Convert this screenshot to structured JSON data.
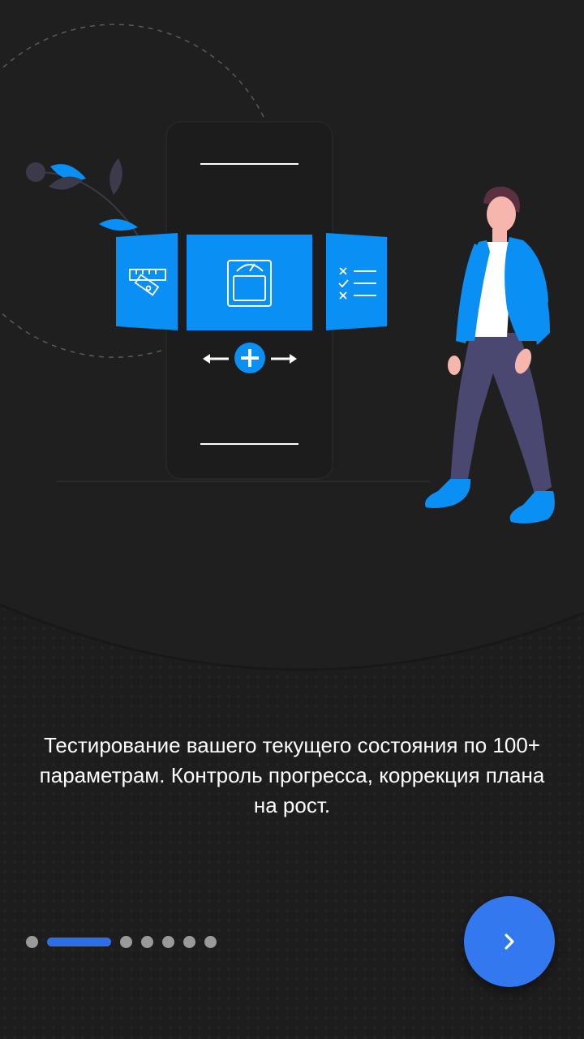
{
  "onboarding": {
    "description": "Тестирование вашего текущего состояния по 100+ параметрам. Контроль прогресса, коррекция плана на рост.",
    "pager": {
      "total": 7,
      "current": 1
    },
    "next_button_icon": "chevron-right-icon"
  },
  "colors": {
    "background": "#1f1f20",
    "accent": "#0a8ff5",
    "button": "#3478f0",
    "pager_active": "#2f6ee6",
    "pager_inactive": "#9a9a9a",
    "text": "#ffffff"
  },
  "illustration_icons": [
    "ruler-icon",
    "scale-icon",
    "checklist-icon",
    "plus-icon",
    "arrow-left-icon",
    "arrow-right-icon",
    "person-figure",
    "leaf-branch"
  ]
}
